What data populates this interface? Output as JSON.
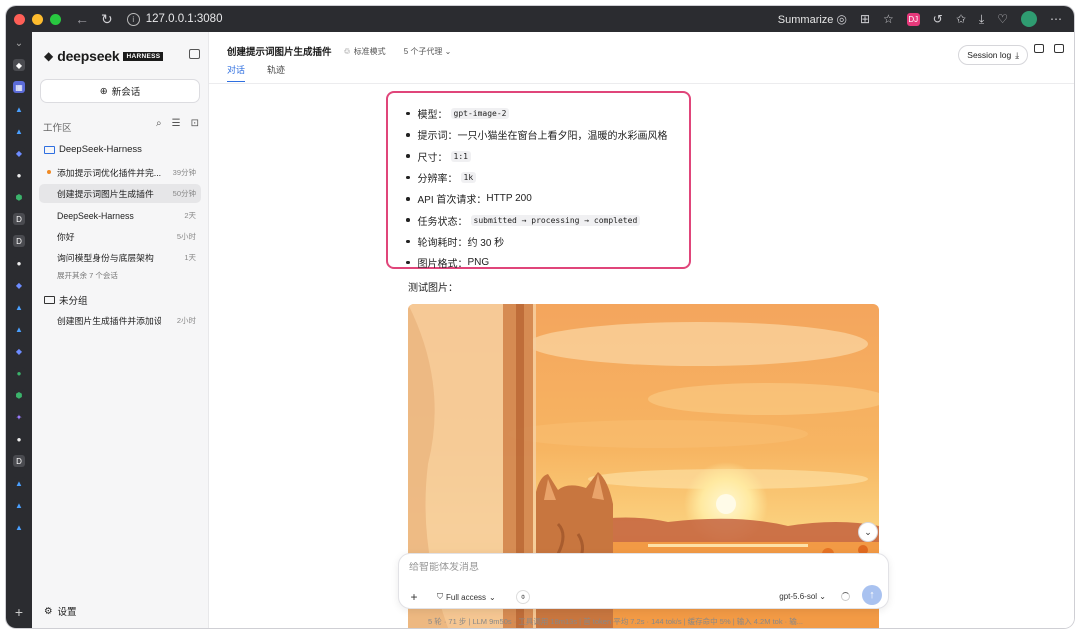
{
  "browser": {
    "url": "127.0.0.1:3080",
    "summarize_label": "Summarize",
    "ext_badge": "DJ"
  },
  "sidebar": {
    "brand": "deepseek",
    "brand_tag": "HARNESS",
    "new_chat": "新会话",
    "workspace_label": "工作区",
    "groups": [
      {
        "title": "DeepSeek-Harness",
        "items": [
          {
            "title": "添加提示词优化插件并完...",
            "time": "39分钟",
            "running": true
          },
          {
            "title": "创建提示词图片生成插件",
            "time": "50分钟",
            "active": true
          },
          {
            "title": "DeepSeek-Harness",
            "time": "2天"
          },
          {
            "title": "你好",
            "time": "5小时"
          },
          {
            "title": "询问模型身份与底层架构",
            "time": "1天"
          }
        ],
        "expand_more": "展开其余 7 个会话"
      },
      {
        "title": "未分组",
        "items": [
          {
            "title": "创建图片生成插件并添加设...",
            "time": "2小时"
          }
        ]
      }
    ],
    "settings": "设置"
  },
  "header": {
    "title": "创建提示词图片生成插件",
    "mode": "标准模式",
    "agents": "5 个子代理",
    "tabs": [
      "对话",
      "轨迹"
    ],
    "session_log": "Session log"
  },
  "message": {
    "items": [
      {
        "label": "模型：",
        "code": "gpt-image-2"
      },
      {
        "label": "提示词：",
        "text": "一只小猫坐在窗台上看夕阳，温暖的水彩画风格"
      },
      {
        "label": "尺寸：",
        "code": "1:1"
      },
      {
        "label": "分辨率：",
        "code": "1k"
      },
      {
        "label": "API 首次请求：",
        "text": "HTTP 200"
      },
      {
        "label": "任务状态：",
        "code": "submitted → processing → completed"
      },
      {
        "label": "轮询耗时：",
        "text": "约 30 秒"
      },
      {
        "label": "图片格式：",
        "text": "PNG"
      }
    ],
    "test_image_label": "测试图片："
  },
  "composer": {
    "placeholder": "给智能体发消息",
    "access": "Full access",
    "model": "gpt-5.6-sol"
  },
  "status": "5 轮 · 71 步  |  LLM 9m50s · 工具调用 18m13s  |  首 token 平均 7.2s · 144 tok/s  |  缓存命中 5%  |  输入 4.2M tok · 输..."
}
